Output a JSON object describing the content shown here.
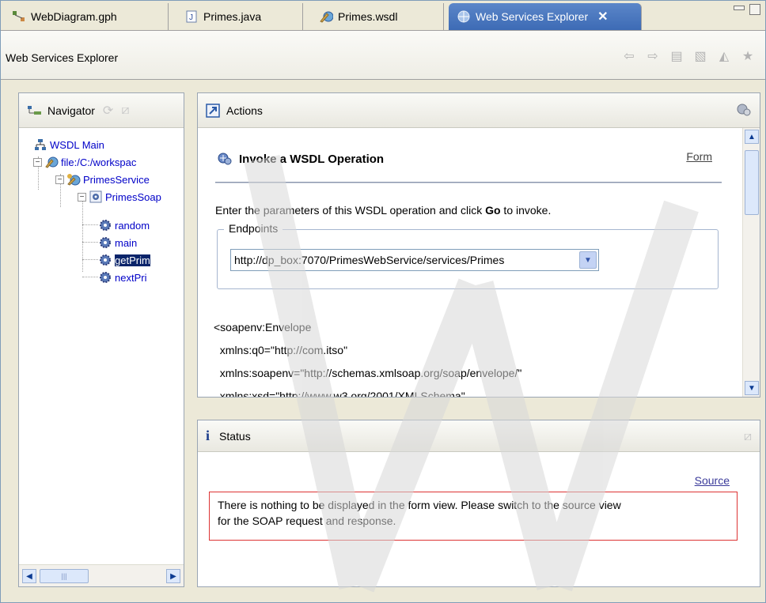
{
  "tabs": [
    {
      "label": "WebDiagram.gph",
      "icon": "diagram-icon"
    },
    {
      "label": "Primes.java",
      "icon": "java-file-icon"
    },
    {
      "label": "Primes.wsdl",
      "icon": "wsdl-file-icon"
    },
    {
      "label": "Web Services Explorer",
      "icon": "globe-icon",
      "active": true
    }
  ],
  "title_bar": {
    "title": "Web Services Explorer"
  },
  "navigator": {
    "title": "Navigator",
    "tree": [
      {
        "label": "WSDL Main"
      },
      {
        "label": "file:/C:/workspac"
      },
      {
        "label": "PrimesService"
      },
      {
        "label": "PrimesSoap"
      },
      {
        "label": "random"
      },
      {
        "label": "main"
      },
      {
        "label": "getPrim",
        "selected": true
      },
      {
        "label": "nextPri"
      }
    ],
    "scroll_thumb": "|||"
  },
  "actions": {
    "title": "Actions",
    "operation_title": "Invoke a WSDL Operation",
    "form_link": "Form",
    "instruction_pre": "Enter the parameters of this WSDL operation and click ",
    "instruction_bold": "Go",
    "instruction_post": " to invoke.",
    "endpoints_legend": "Endpoints",
    "endpoint_value": "http://dp_box:7070/PrimesWebService/services/Primes",
    "xml_lines": [
      "<soapenv:Envelope",
      "  xmlns:q0=\"http://com.itso\"",
      "  xmlns:soapenv=\"http://schemas.xmlsoap.org/soap/envelope/\"",
      "  xmlns:xsd=\"http://www.w3.org/2001/XMLSchema\""
    ]
  },
  "status": {
    "title": "Status",
    "source_link": "Source",
    "message_line1": "There is nothing to be displayed in the form view. Please switch to the source view",
    "message_line2": "for the SOAP request and response."
  },
  "colors": {
    "active_tab": "#3d6bb5",
    "link": "#0000c8",
    "selection": "#0a246a",
    "error_border": "#dd3333"
  }
}
